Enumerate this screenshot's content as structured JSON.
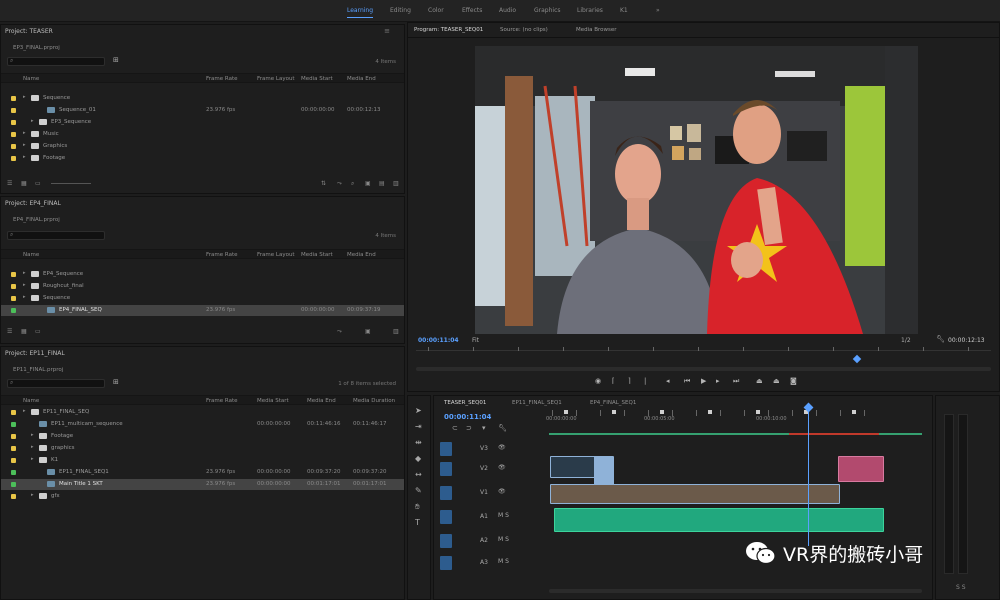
{
  "workspaces": [
    "Learning",
    "Editing",
    "Color",
    "Effects",
    "Audio",
    "Graphics",
    "Libraries",
    "K1"
  ],
  "active_workspace": 0,
  "panels": [
    {
      "title": "Project: TEASER",
      "subtitle": "EP3_FINAL.prproj",
      "items": "4 Items",
      "columns": [
        "Name",
        "Frame Rate",
        "Frame Layout",
        "Media Start",
        "Media End"
      ],
      "rows": [
        {
          "name": "Sequence",
          "indent": 0,
          "kind": "folder",
          "label": "#e8c547",
          "cells": [
            "",
            "",
            "",
            ""
          ]
        },
        {
          "name": "Sequence_01",
          "indent": 2,
          "kind": "seq",
          "label": "#e8c547",
          "cells": [
            "23.976 fps",
            "",
            "00:00:00:00",
            "00:00:12:13"
          ]
        },
        {
          "name": "EP3_Sequence",
          "indent": 1,
          "kind": "folder",
          "label": "#e8c547",
          "cells": [
            "",
            "",
            "",
            ""
          ]
        },
        {
          "name": "Music",
          "indent": 0,
          "kind": "folder",
          "label": "#e8c547",
          "cells": [
            "",
            "",
            "",
            ""
          ]
        },
        {
          "name": "Graphics",
          "indent": 0,
          "kind": "folder",
          "label": "#e8c547",
          "cells": [
            "",
            "",
            "",
            ""
          ]
        },
        {
          "name": "Footage",
          "indent": 0,
          "kind": "folder",
          "label": "#e8c547",
          "cells": [
            "",
            "",
            "",
            ""
          ]
        }
      ]
    },
    {
      "title": "Project: EP4_FINAL",
      "subtitle": "EP4_FINAL.prproj",
      "items": "4 Items",
      "columns": [
        "Name",
        "Frame Rate",
        "Frame Layout",
        "Media Start",
        "Media End"
      ],
      "rows": [
        {
          "name": "EP4_Sequence",
          "indent": 0,
          "kind": "folder",
          "label": "#e8c547",
          "cells": [
            "",
            "",
            "",
            ""
          ]
        },
        {
          "name": "Roughcut_final",
          "indent": 0,
          "kind": "folder",
          "label": "#e8c547",
          "cells": [
            "",
            "",
            "",
            ""
          ]
        },
        {
          "name": "Sequence",
          "indent": 0,
          "kind": "folder",
          "label": "#e8c547",
          "cells": [
            "",
            "",
            "",
            ""
          ]
        },
        {
          "name": "EP4_FINAL_SEQ",
          "indent": 2,
          "kind": "seq",
          "label": "#4cbf5a",
          "cells": [
            "23.976 fps",
            "",
            "00:00:00:00",
            "00:09:37:19"
          ],
          "selected": true
        }
      ]
    },
    {
      "title": "Project: EP11_FINAL",
      "subtitle": "EP11_FINAL.prproj",
      "items": "1 of 8 items selected",
      "columns": [
        "Name",
        "Frame Rate",
        "Media Start",
        "Media End",
        "Media Duration"
      ],
      "rows": [
        {
          "name": "EP11_FINAL_SEQ",
          "indent": 0,
          "kind": "folder",
          "label": "#e8c547",
          "cells": [
            "",
            "",
            "",
            ""
          ]
        },
        {
          "name": "EP11_multicam_sequence",
          "indent": 1,
          "kind": "seq",
          "label": "#4cbf5a",
          "cells": [
            "",
            "00:00:00:00",
            "00:11:46:16",
            "00:11:46:17"
          ]
        },
        {
          "name": "Footage",
          "indent": 1,
          "kind": "folder",
          "label": "#e8c547",
          "cells": [
            "",
            "",
            "",
            ""
          ]
        },
        {
          "name": "graphics",
          "indent": 1,
          "kind": "folder",
          "label": "#e8c547",
          "cells": [
            "",
            "",
            "",
            ""
          ]
        },
        {
          "name": "K1",
          "indent": 1,
          "kind": "folder",
          "label": "#e8c547",
          "cells": [
            "",
            "",
            "",
            ""
          ]
        },
        {
          "name": "EP11_FINAL_SEQ1",
          "indent": 2,
          "kind": "seq",
          "label": "#4cbf5a",
          "cells": [
            "23.976 fps",
            "00:00:00:00",
            "00:09:37:20",
            "00:09:37:20"
          ]
        },
        {
          "name": "Main Title 1 SKT",
          "indent": 2,
          "kind": "clip",
          "label": "#4cbf5a",
          "cells": [
            "23.976 fps",
            "00:00:00:00",
            "00:01:17:01",
            "00:01:17:01"
          ],
          "selected": true
        },
        {
          "name": "gfx",
          "indent": 1,
          "kind": "folder",
          "label": "#e8c547",
          "cells": [
            "",
            "",
            "",
            ""
          ]
        }
      ]
    }
  ],
  "program": {
    "tabs": [
      "Program: TEASER_SEQ01",
      "Source: (no clips)",
      "Media Browser"
    ],
    "timecode_left": "00:00:11:04",
    "fit": "Fit",
    "quality": "1/2",
    "timecode_right": "00:00:12:13"
  },
  "timeline": {
    "tabs": [
      "TEASER_SEQ01",
      "EP11_FINAL_SEQ1",
      "EP4_FINAL_SEQ1"
    ],
    "timecode": "00:00:11:04",
    "ruler": [
      "00:00:00:00",
      "00:00:05:00",
      "00:00:10:00"
    ],
    "tracks": [
      "V3",
      "V2",
      "V1",
      "A1",
      "A2",
      "A3"
    ]
  },
  "watermark": "VR界的搬砖小哥",
  "colors": {
    "accent": "#5aa0ff",
    "audio_clip": "#21a87e",
    "video_clip": "#8fb2d8",
    "folder_label": "#e8c547",
    "clip_label": "#4cbf5a"
  }
}
